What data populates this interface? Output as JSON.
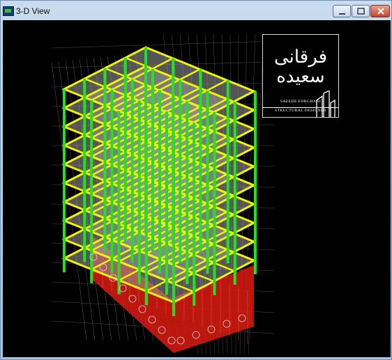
{
  "window": {
    "title": "3-D View",
    "app_icon": "etabs-app-icon",
    "controls": [
      "minimize-icon",
      "maximize-icon",
      "close-icon"
    ]
  },
  "viewport": {
    "background_color": "#000000",
    "colors": {
      "columns": "#22e022",
      "beams": "#f2f20c",
      "shear_walls": "#d01a10",
      "slabs": "#9a9a9a",
      "grid_lines": "#bfbfbf"
    }
  },
  "watermark": {
    "persian_line1": "فرقانی",
    "persian_line2": "سعیده",
    "name": "SAEEDE FORGHANI",
    "role": "STRUCTURAL DESIGNER"
  }
}
